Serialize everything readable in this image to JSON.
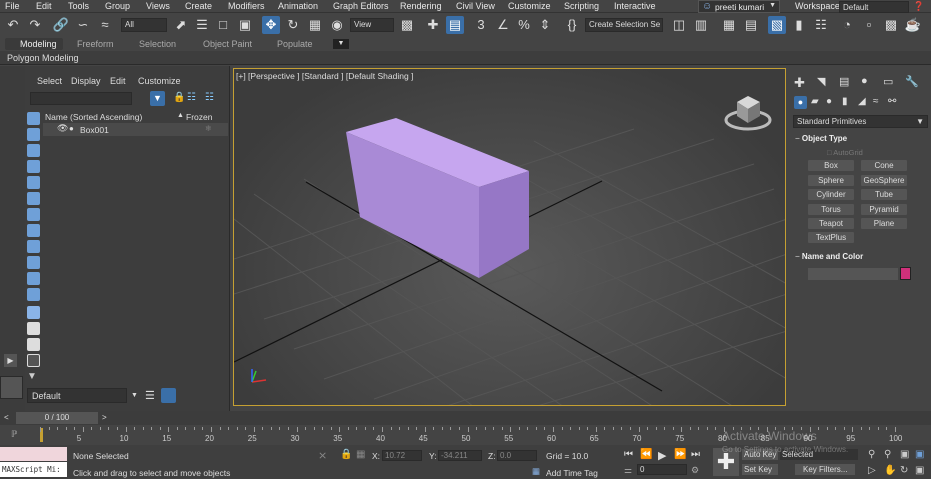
{
  "menu": [
    "File",
    "Edit",
    "Tools",
    "Group",
    "Views",
    "Create",
    "Modifiers",
    "Animation",
    "Graph Editors",
    "Rendering",
    "Civil View",
    "Customize",
    "Scripting",
    "Interactive"
  ],
  "user": "preeti kumari",
  "workspaces_label": "Workspaces:",
  "workspace_value": "Default",
  "selection_filter": "All",
  "ref_coord": "View",
  "selection_set": "Create Selection Se",
  "ribbon_tabs": [
    "Modeling",
    "Freeform",
    "Selection",
    "Object Paint",
    "Populate"
  ],
  "ribbon_sub": "Polygon Modeling",
  "scene_menu": [
    "Select",
    "Display",
    "Edit",
    "Customize"
  ],
  "scene_columns": {
    "name": "Name (Sorted Ascending)",
    "frozen": "Frozen"
  },
  "scene_items": [
    "Box001"
  ],
  "layer": "Default",
  "viewport_label": "[+] [Perspective ] [Standard ] [Default Shading ]",
  "command_panel": {
    "category": "Standard Primitives",
    "object_type_title": "Object Type",
    "autogrid": "AutoGrid",
    "buttons": [
      "Box",
      "Cone",
      "Sphere",
      "GeoSphere",
      "Cylinder",
      "Tube",
      "Torus",
      "Pyramid",
      "Teapot",
      "Plane",
      "TextPlus"
    ],
    "name_color_title": "Name and Color",
    "object_color": "#d0307a"
  },
  "timeline": {
    "frame": "0 / 100",
    "ticks": [
      "5",
      "10",
      "15",
      "20",
      "25",
      "30",
      "35",
      "40",
      "45",
      "50",
      "55",
      "60",
      "65",
      "70",
      "75",
      "80",
      "85",
      "90",
      "95",
      "100"
    ]
  },
  "status": {
    "maxscript": "MAXScript Mi:",
    "selection": "None Selected",
    "prompt": "Click and drag to select and move objects",
    "x_label": "X:",
    "x_value": "10.72",
    "y_label": "Y:",
    "y_value": "-34.211",
    "z_label": "Z:",
    "z_value": "0.0",
    "grid": "Grid = 10.0",
    "add_time_tag": "Add Time Tag",
    "auto_key": "Auto Key",
    "set_key": "Set Key",
    "selected": "Selected",
    "key_filters": "Key Filters...",
    "current_frame": "0",
    "watermark": "Activate Windows",
    "watermark_sub": "Go to Settings to activate Windows."
  },
  "colors": {
    "box_front": "#a98ad6",
    "box_top": "#c6a6ef",
    "box_side": "#9677c6",
    "viewport_border": "#c5a032",
    "accent": "#3a6fa8"
  }
}
